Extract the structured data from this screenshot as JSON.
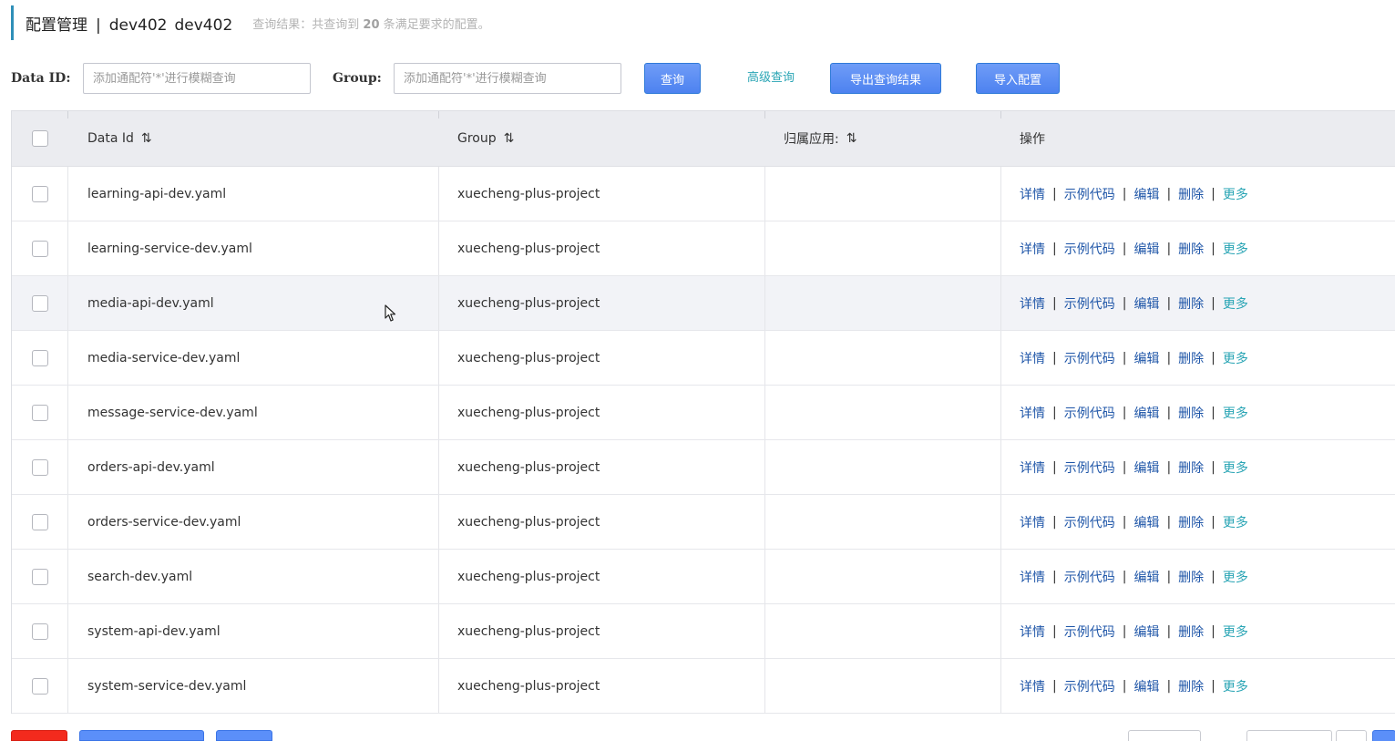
{
  "header": {
    "title": "配置管理",
    "separator": "|",
    "namespace_name": "dev402",
    "namespace_id": "dev402",
    "result_prefix": "查询结果：共查询到",
    "result_count": "20",
    "result_suffix": "条满足要求的配置。"
  },
  "filter": {
    "data_id_label": "Data ID:",
    "data_id_placeholder": "添加通配符'*'进行模糊查询",
    "group_label": "Group:",
    "group_placeholder": "添加通配符'*'进行模糊查询",
    "search_button": "查询",
    "advanced_link": "高级查询",
    "export_button": "导出查询结果",
    "import_button": "导入配置"
  },
  "table": {
    "columns": {
      "data_id": "Data Id",
      "group": "Group",
      "app": "归属应用:",
      "actions": "操作"
    },
    "sort_icon": "⇅",
    "actions": {
      "detail": "详情",
      "sample": "示例代码",
      "edit": "编辑",
      "delete": "删除",
      "more": "更多",
      "sep": "|"
    },
    "rows": [
      {
        "data_id": "learning-api-dev.yaml",
        "group": "xuecheng-plus-project",
        "app": ""
      },
      {
        "data_id": "learning-service-dev.yaml",
        "group": "xuecheng-plus-project",
        "app": ""
      },
      {
        "data_id": "media-api-dev.yaml",
        "group": "xuecheng-plus-project",
        "app": ""
      },
      {
        "data_id": "media-service-dev.yaml",
        "group": "xuecheng-plus-project",
        "app": ""
      },
      {
        "data_id": "message-service-dev.yaml",
        "group": "xuecheng-plus-project",
        "app": ""
      },
      {
        "data_id": "orders-api-dev.yaml",
        "group": "xuecheng-plus-project",
        "app": ""
      },
      {
        "data_id": "orders-service-dev.yaml",
        "group": "xuecheng-plus-project",
        "app": ""
      },
      {
        "data_id": "search-dev.yaml",
        "group": "xuecheng-plus-project",
        "app": ""
      },
      {
        "data_id": "system-api-dev.yaml",
        "group": "xuecheng-plus-project",
        "app": ""
      },
      {
        "data_id": "system-service-dev.yaml",
        "group": "xuecheng-plus-project",
        "app": ""
      }
    ]
  },
  "colors": {
    "accent_bar": "#2f8fb8",
    "primary_button": "#5b8ff9",
    "link": "#1f56a8",
    "more_link": "#2aa5b5",
    "danger": "#f32a1d"
  },
  "icons": {
    "sort": "sort-icon",
    "cursor": "cursor-icon"
  }
}
